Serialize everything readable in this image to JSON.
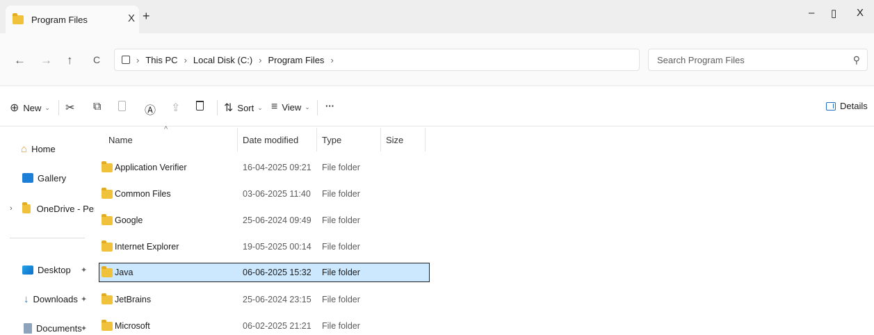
{
  "tab": {
    "title": "Program Files",
    "close_glyph": "X",
    "new_tab_glyph": "+"
  },
  "window_controls": {
    "minimize": "–",
    "restore": "▯",
    "close": "X"
  },
  "nav": {
    "back": "←",
    "forward": "→",
    "up": "↑",
    "refresh": "C",
    "breadcrumb": [
      "This PC",
      "Local Disk (C:)",
      "Program Files"
    ],
    "search_placeholder": "Search Program Files",
    "search_glyph": "⚲"
  },
  "commands": {
    "new": "New",
    "sort": "Sort",
    "view": "View",
    "more": "···",
    "details": "Details",
    "icons": {
      "new": "⊕",
      "cut": "✂",
      "copy": "⧉",
      "paste": "📋",
      "rename": "Ⓐ",
      "share": "⇪",
      "delete": "🗑",
      "sort": "⇅",
      "view": "≡"
    }
  },
  "sidebar": {
    "home": "Home",
    "gallery": "Gallery",
    "onedrive": "OneDrive - Persona",
    "desktop": "Desktop",
    "downloads": "Downloads",
    "documents": "Documents",
    "pin_glyph": "✦",
    "expand_glyph": "›"
  },
  "columns": {
    "name": "Name",
    "date": "Date modified",
    "type": "Type",
    "size": "Size",
    "sort_glyph": "^"
  },
  "files": [
    {
      "name": "Application Verifier",
      "date": "16-04-2025 09:21",
      "type": "File folder"
    },
    {
      "name": "Common Files",
      "date": "03-06-2025 11:40",
      "type": "File folder"
    },
    {
      "name": "Google",
      "date": "25-06-2024 09:49",
      "type": "File folder"
    },
    {
      "name": "Internet Explorer",
      "date": "19-05-2025 00:14",
      "type": "File folder"
    },
    {
      "name": "Java",
      "date": "06-06-2025 15:32",
      "type": "File folder"
    },
    {
      "name": "JetBrains",
      "date": "25-06-2024 23:15",
      "type": "File folder"
    },
    {
      "name": "Microsoft",
      "date": "06-02-2025 21:21",
      "type": "File folder"
    }
  ],
  "selected_row": "Java",
  "colors": {
    "selection": "#cce8ff",
    "folder": "#f0c23c",
    "accent": "#1d7fd8"
  }
}
